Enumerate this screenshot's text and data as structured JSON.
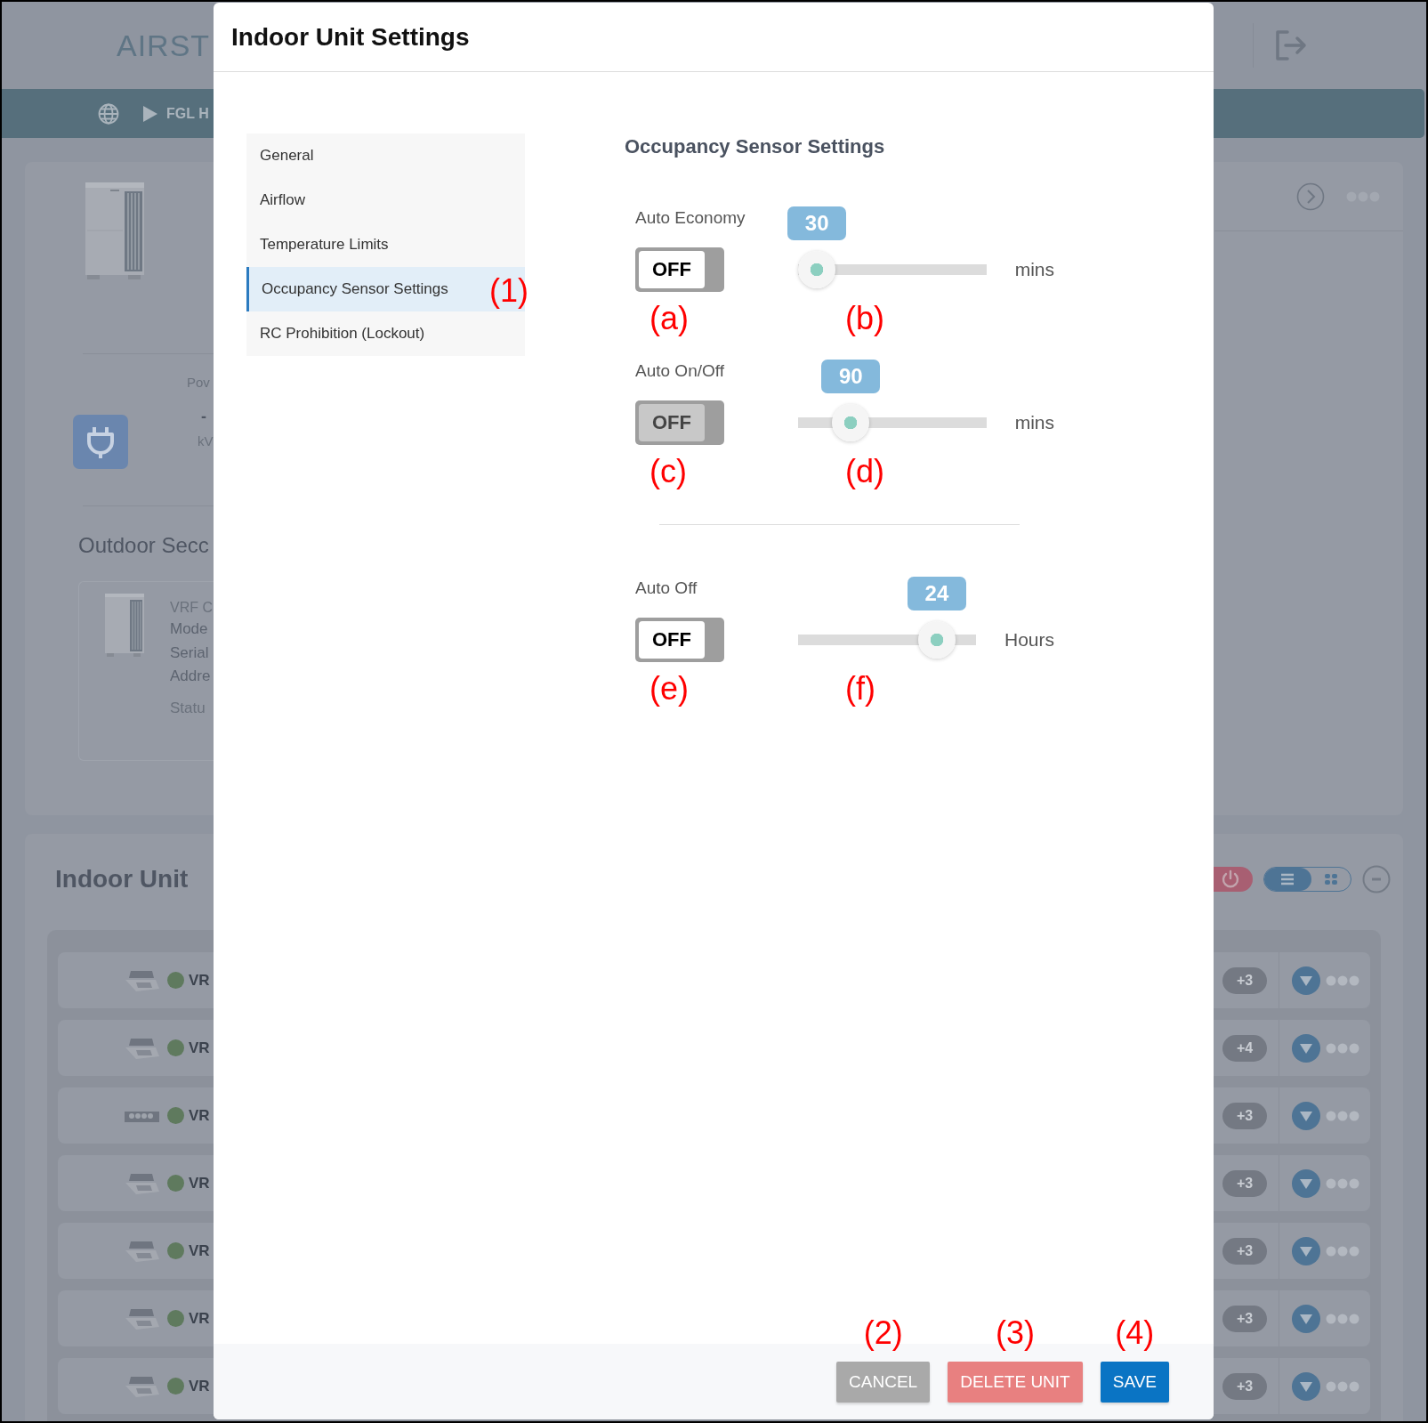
{
  "background": {
    "logo": "AIRST",
    "breadcrumb": "FGL H",
    "outdoor_card": {
      "power_label": "Pov",
      "power_value": "-",
      "power_unit": "kV",
      "section_title": "Outdoor Secc",
      "unit_name": "VRF C",
      "unit_fields": [
        "Mode",
        "Serial",
        "Addre"
      ],
      "status_label": "Statu"
    },
    "indoor": {
      "title": "Indoor Unit",
      "view_options": [
        {
          "kind": "list",
          "selected": true
        },
        {
          "kind": "grid",
          "selected": false
        }
      ],
      "rows": [
        {
          "kind": "cassette",
          "name": "VR",
          "badge": "+3"
        },
        {
          "kind": "cassette",
          "name": "VR",
          "badge": "+4"
        },
        {
          "kind": "duct",
          "name": "VR",
          "badge": "+3"
        },
        {
          "kind": "cassette",
          "name": "VR",
          "badge": "+3"
        },
        {
          "kind": "cassette",
          "name": "VR",
          "badge": "+3"
        },
        {
          "kind": "cassette",
          "name": "VR",
          "badge": "+3"
        },
        {
          "kind": "cassette",
          "name": "VR",
          "badge": "+3"
        }
      ]
    }
  },
  "modal": {
    "title": "Indoor Unit Settings",
    "menu": [
      {
        "label": "General",
        "selected": false
      },
      {
        "label": "Airflow",
        "selected": false
      },
      {
        "label": "Temperature Limits",
        "selected": false
      },
      {
        "label": "Occupancy Sensor Settings",
        "selected": true,
        "annotation": "(1)"
      },
      {
        "label": "RC Prohibition (Lockout)",
        "selected": false
      }
    ],
    "section_title": "Occupancy Sensor Settings",
    "setting_groups": [
      [
        {
          "label": "Auto Economy",
          "toggle": {
            "text": "OFF",
            "on": false,
            "disabled": false
          },
          "slider": {
            "value_label": "30",
            "level": 0.1
          },
          "unit": "mins",
          "annotations": [
            "(a)",
            "(b)"
          ]
        },
        {
          "label": "Auto On/Off",
          "toggle": {
            "text": "OFF",
            "on": false,
            "disabled": true
          },
          "slider": {
            "value_label": "90",
            "level": 0.28
          },
          "unit": "mins",
          "annotations": [
            "(c)",
            "(d)"
          ]
        }
      ],
      [
        {
          "label": "Auto Off",
          "toggle": {
            "text": "OFF",
            "on": false,
            "disabled": false
          },
          "slider": {
            "value_label": "24",
            "level": 0.78
          },
          "unit": "Hours",
          "annotations": [
            "(e)",
            "(f)"
          ]
        }
      ]
    ],
    "buttons": [
      {
        "label": "CANCEL",
        "kind": "secondary",
        "annotation": "(2)"
      },
      {
        "label": "DELETE UNIT",
        "kind": "danger",
        "annotation": "(3)"
      },
      {
        "label": "SAVE",
        "kind": "primary",
        "annotation": "(4)"
      }
    ]
  }
}
